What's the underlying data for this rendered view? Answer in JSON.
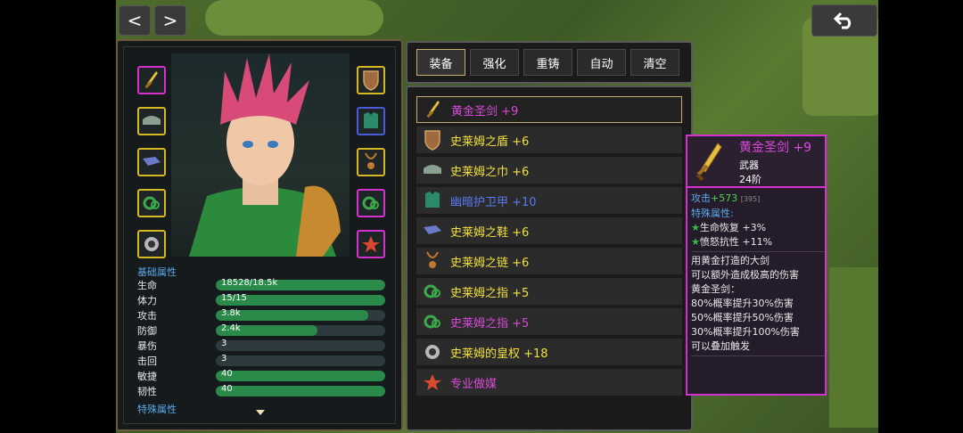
{
  "nav": {
    "prev_label": "<",
    "next_label": ">"
  },
  "tabs": [
    {
      "label": "装备",
      "active": true
    },
    {
      "label": "强化",
      "active": false
    },
    {
      "label": "重铸",
      "active": false
    },
    {
      "label": "自动",
      "active": false
    },
    {
      "label": "清空",
      "active": false
    }
  ],
  "hero": {
    "stats_title": "基础属性",
    "special_title": "特殊属性",
    "stats": [
      {
        "label": "生命",
        "value": "18528/18.5k",
        "fill": 1.0
      },
      {
        "label": "体力",
        "value": "15/15",
        "fill": 1.0
      },
      {
        "label": "攻击",
        "value": "3.8k",
        "fill": 0.9
      },
      {
        "label": "防御",
        "value": "2.4k",
        "fill": 0.6
      },
      {
        "label": "暴伤",
        "value": "3",
        "fill": 0
      },
      {
        "label": "击回",
        "value": "3",
        "fill": 0
      },
      {
        "label": "敏捷",
        "value": "40",
        "fill": 1.0
      },
      {
        "label": "韧性",
        "value": "40",
        "fill": 1.0
      }
    ]
  },
  "equipment": [
    {
      "name": "黄金圣剑 +9",
      "color": "#d84ad8",
      "icon": "sword-icon",
      "selected": true
    },
    {
      "name": "史莱姆之盾 +6",
      "color": "#f0e040",
      "icon": "shield-icon",
      "selected": false
    },
    {
      "name": "史莱姆之巾 +6",
      "color": "#f0e040",
      "icon": "headband-icon",
      "selected": false
    },
    {
      "name": "幽暗护卫甲 +10",
      "color": "#5a78f0",
      "icon": "armor-icon",
      "selected": false
    },
    {
      "name": "史莱姆之鞋 +6",
      "color": "#f0e040",
      "icon": "boots-icon",
      "selected": false
    },
    {
      "name": "史莱姆之链 +6",
      "color": "#f0e040",
      "icon": "necklace-icon",
      "selected": false
    },
    {
      "name": "史莱姆之指 +5",
      "color": "#f0e040",
      "icon": "ring-icon",
      "selected": false
    },
    {
      "name": "史莱姆之指 +5",
      "color": "#d84ad8",
      "icon": "ring-icon",
      "selected": false
    },
    {
      "name": "史莱姆的皇权 +18",
      "color": "#f0e040",
      "icon": "scepter-icon",
      "selected": false
    },
    {
      "name": "专业做媒",
      "color": "#d84ad8",
      "icon": "cupid-icon",
      "selected": false
    }
  ],
  "detail": {
    "name": "黄金圣剑 +9",
    "type": "武器",
    "tier": "24阶",
    "attack_label": "攻击",
    "attack_value": "+573",
    "attack_base": "[395]",
    "special_label": "特殊属性:",
    "special_1": "生命恢复 +3%",
    "special_2": "愤怒抗性 +11%",
    "desc_1": "用黄金打造的大剑",
    "desc_2": "可以额外造成极高的伤害",
    "effect_title": "黄金圣剑：",
    "effect_1": "80%概率提升30%伤害",
    "effect_2": "50%概率提升50%伤害",
    "effect_3": "30%概率提升100%伤害",
    "effect_4": "可以叠加触发"
  },
  "colors": {
    "gold": "#f0e040",
    "magenta": "#d84ad8",
    "blue": "#5a78f0",
    "stat_title": "#5aa8e8",
    "bar_green": "#2a8a4a"
  }
}
